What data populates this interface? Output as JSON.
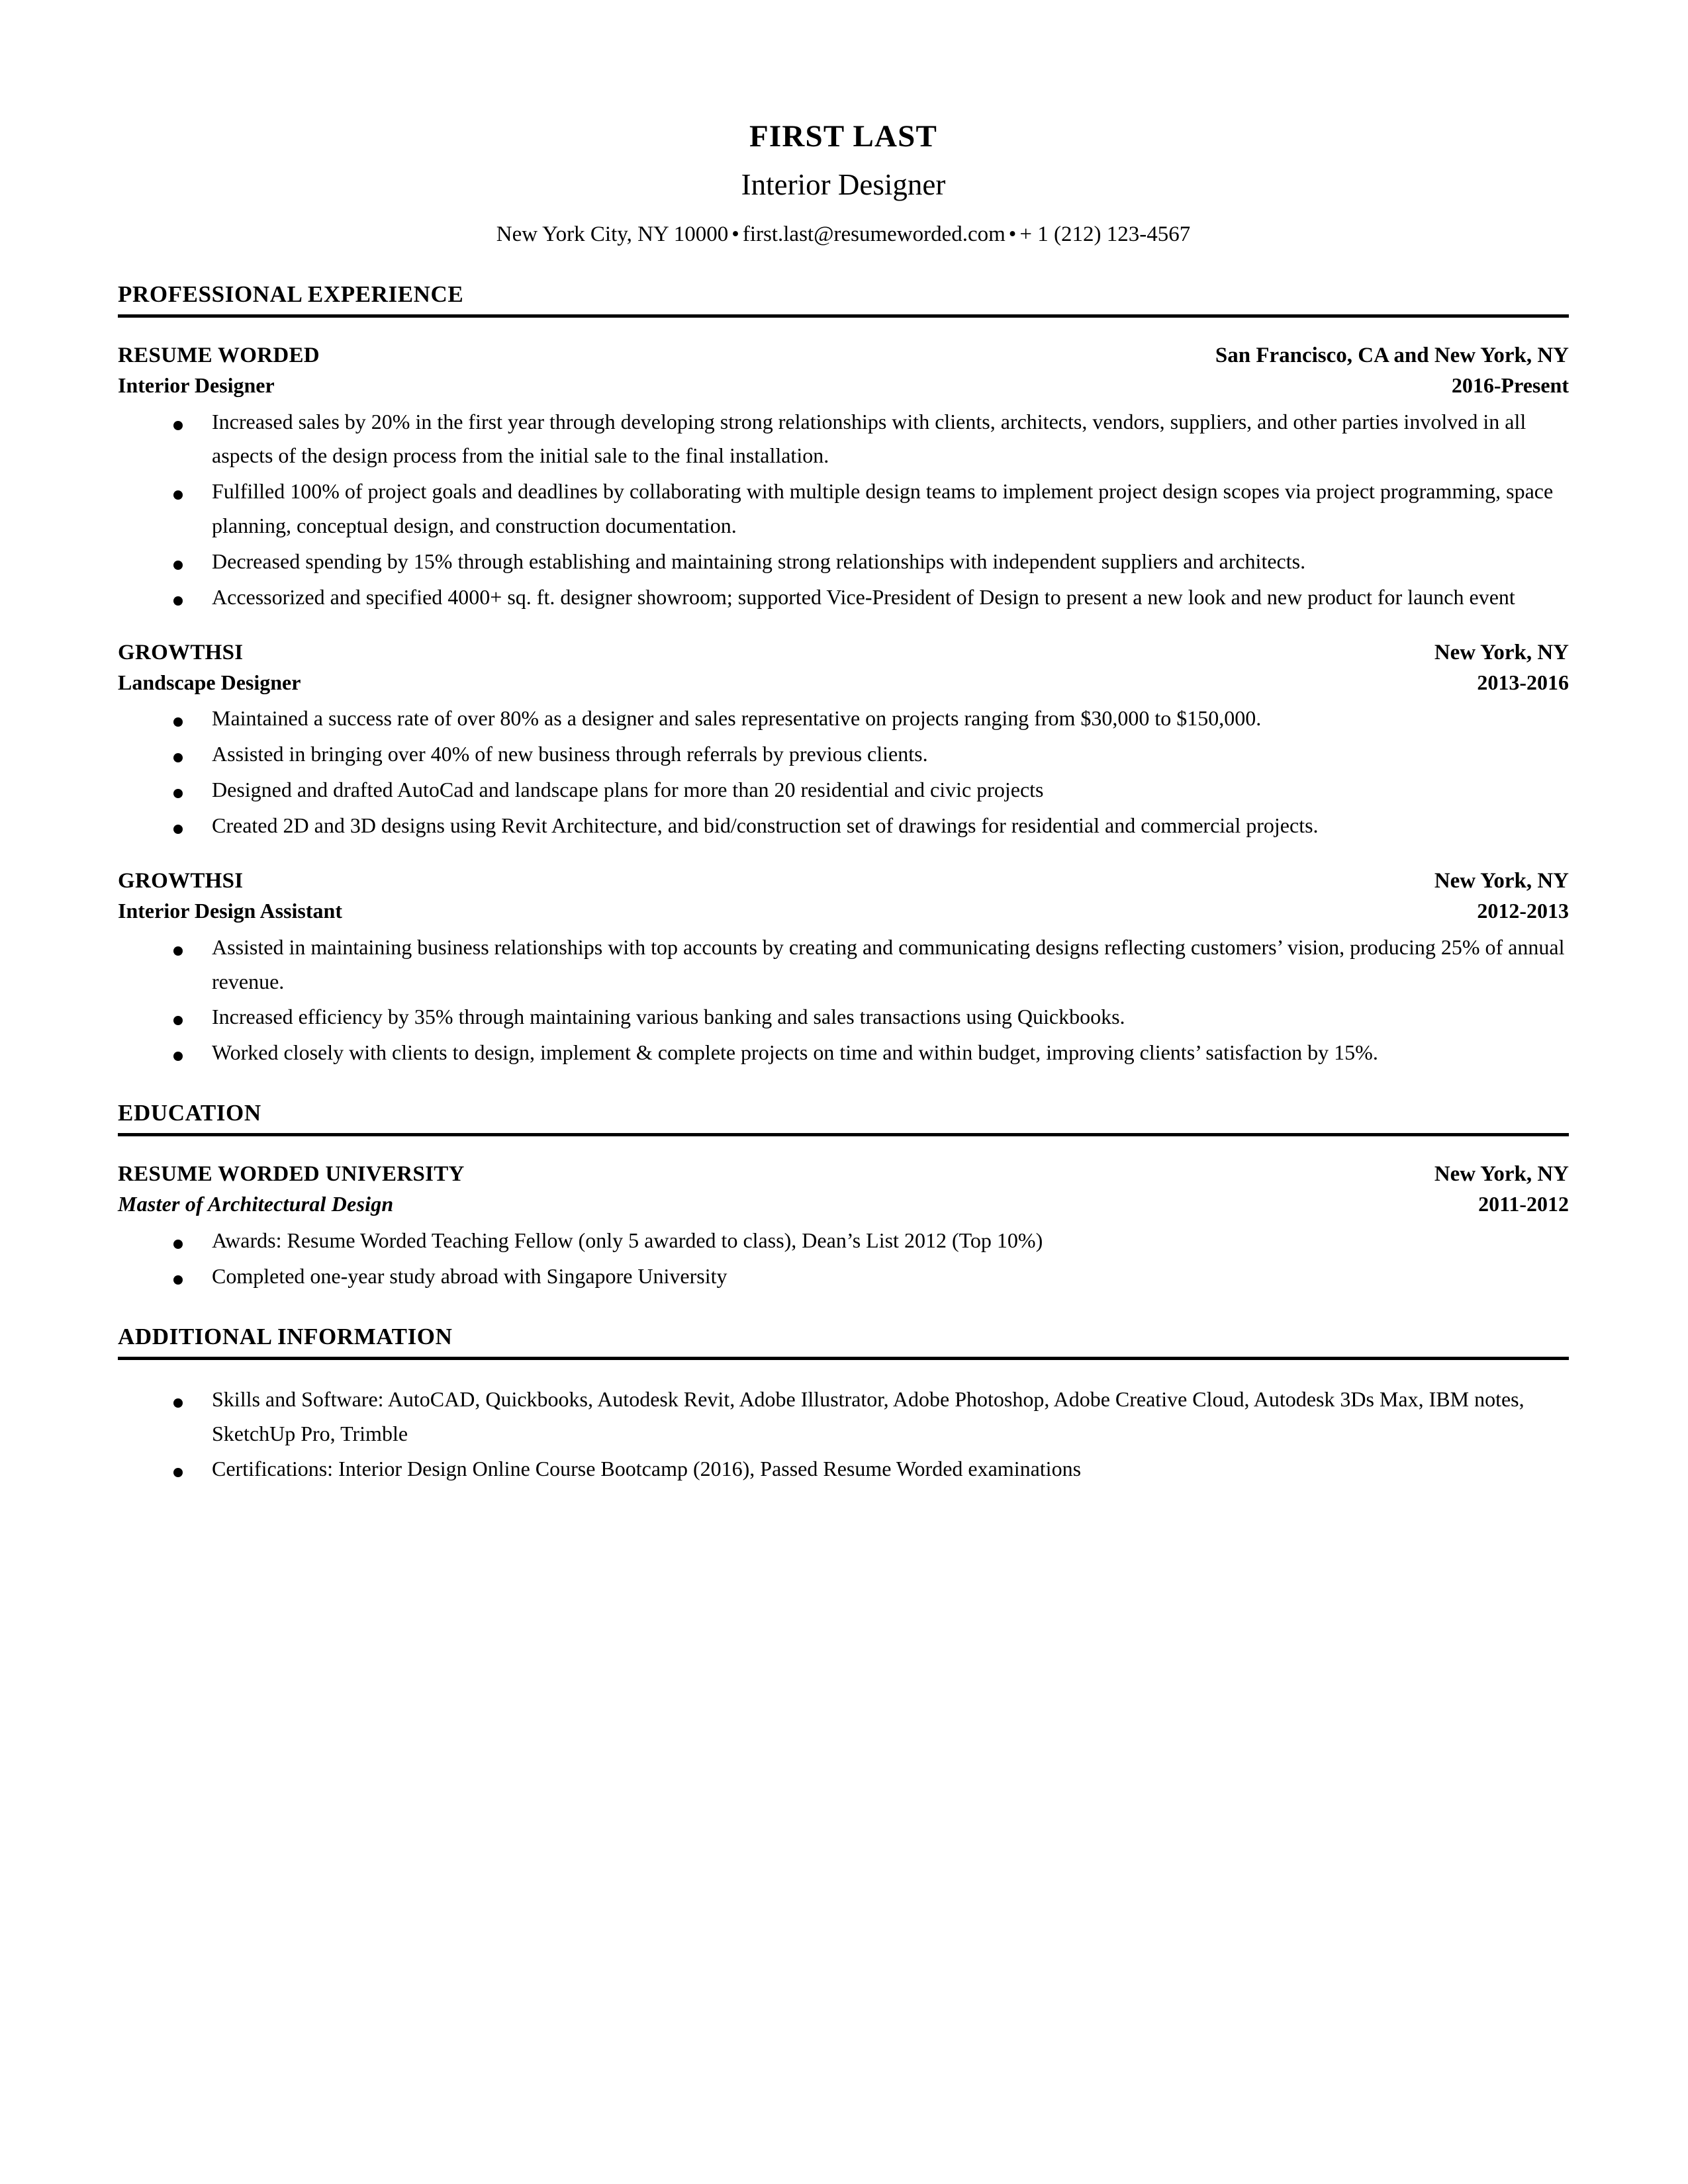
{
  "header": {
    "name": "FIRST LAST",
    "title": "Interior Designer",
    "location": "New York City, NY 10000",
    "separator": "•",
    "email": "first.last@resumeworded.com",
    "phone": "+ 1 (212) 123-4567"
  },
  "sections": [
    {
      "heading": "PROFESSIONAL EXPERIENCE",
      "entries": [
        {
          "org": "RESUME WORDED",
          "location": "San Francisco, CA and New York, NY",
          "role": "Interior Designer",
          "dates": "2016-Present",
          "bullets": [
            "Increased sales by 20% in the first year through developing strong relationships with clients, architects, vendors, suppliers, and other parties involved in all aspects of the design process from the initial sale to the final installation.",
            "Fulfilled 100% of project goals and deadlines by collaborating with multiple design teams to implement project design scopes via project programming, space planning, conceptual design, and construction documentation.",
            "Decreased spending by 15% through establishing and maintaining strong relationships with independent suppliers and architects.",
            "Accessorized and specified 4000+ sq. ft. designer showroom; supported Vice-President of Design to present a new look and new product for launch event"
          ]
        },
        {
          "org": "GROWTHSI",
          "location": "New York, NY",
          "role": "Landscape Designer",
          "dates": "2013-2016",
          "bullets": [
            "Maintained a success rate of over 80% as a designer and sales representative on projects ranging from $30,000 to $150,000.",
            "Assisted in bringing over 40% of new business through referrals by previous clients.",
            "Designed and drafted AutoCad and landscape plans for more than 20 residential and civic projects",
            "Created 2D and 3D designs using Revit Architecture, and bid/construction set of drawings for residential and commercial projects."
          ]
        },
        {
          "org": "GROWTHSI",
          "location": "New York, NY",
          "role": "Interior Design Assistant",
          "dates": "2012-2013",
          "bullets": [
            "Assisted in maintaining business relationships with top accounts by creating and communicating designs reflecting customers’ vision, producing 25% of annual revenue.",
            "Increased efficiency by 35% through maintaining various banking and sales transactions using Quickbooks.",
            "Worked closely with clients to design, implement & complete projects on time and within budget, improving clients’ satisfaction by 15%."
          ]
        }
      ]
    },
    {
      "heading": "EDUCATION",
      "entries": [
        {
          "org": "RESUME WORDED UNIVERSITY",
          "location": "New York, NY",
          "role": "Master of Architectural Design",
          "role_italic": true,
          "dates": "2011-2012",
          "bullets": [
            "Awards: Resume Worded Teaching Fellow (only 5 awarded to class), Dean’s List 2012 (Top 10%)",
            "Completed one-year study abroad with Singapore University"
          ]
        }
      ]
    },
    {
      "heading": "ADDITIONAL INFORMATION",
      "entries": [
        {
          "bullets": [
            "Skills and Software: AutoCAD, Quickbooks, Autodesk Revit, Adobe Illustrator, Adobe Photoshop, Adobe Creative Cloud, Autodesk 3Ds Max, IBM notes, SketchUp Pro, Trimble",
            "Certifications: Interior Design Online Course Bootcamp (2016), Passed Resume Worded examinations"
          ]
        }
      ]
    }
  ]
}
